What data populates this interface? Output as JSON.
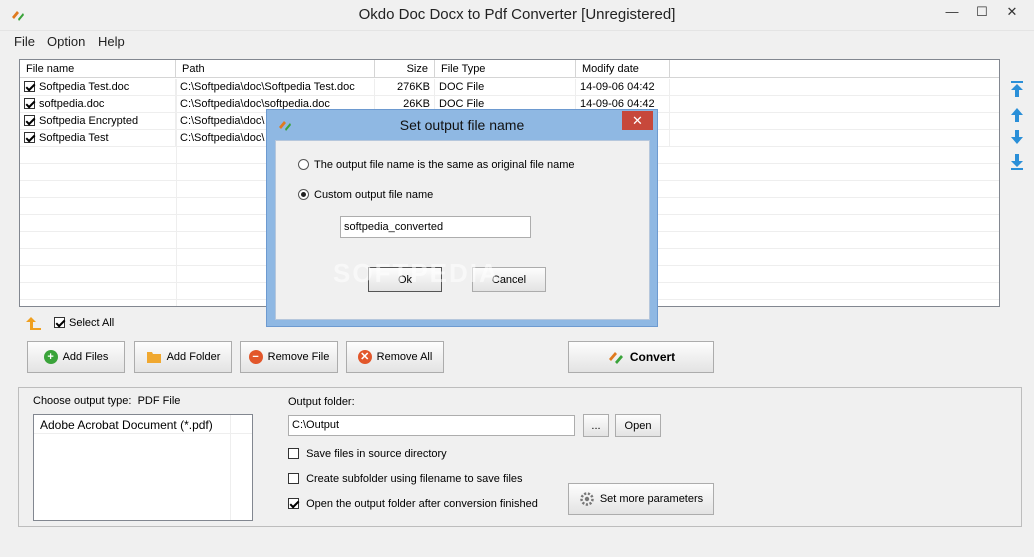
{
  "window": {
    "title": "Okdo Doc Docx to Pdf Converter [Unregistered]",
    "minimize": "—",
    "maximize": "☐",
    "close": "✕"
  },
  "menu": [
    "File",
    "Option",
    "Help"
  ],
  "table": {
    "columns": [
      "File name",
      "Path",
      "Size",
      "File Type",
      "Modify date"
    ],
    "rows": [
      {
        "checked": true,
        "name": "Softpedia Test.doc",
        "path": "C:\\Softpedia\\doc\\Softpedia Test.doc",
        "size": "276KB",
        "type": "DOC File",
        "date": "14-09-06 04:42"
      },
      {
        "checked": true,
        "name": "softpedia.doc",
        "path": "C:\\Softpedia\\doc\\softpedia.doc",
        "size": "26KB",
        "type": "DOC File",
        "date": "14-09-06 04:42"
      },
      {
        "checked": true,
        "name": "Softpedia Encrypted",
        "path": "C:\\Softpedia\\doc\\",
        "size": "",
        "type": "",
        "date": ""
      },
      {
        "checked": true,
        "name": "Softpedia Test",
        "path": "C:\\Softpedia\\doc\\",
        "size": "",
        "type": "",
        "date": ""
      }
    ]
  },
  "select_all": {
    "label": "Select All",
    "checked": true
  },
  "buttons": {
    "add_files": "Add Files",
    "add_folder": "Add Folder",
    "remove_file": "Remove File",
    "remove_all": "Remove All",
    "convert": "Convert"
  },
  "output": {
    "type_label": "Choose output type:",
    "type_value": "PDF File",
    "type_options": [
      "Adobe Acrobat Document (*.pdf)"
    ],
    "folder_label": "Output folder:",
    "folder_value": "C:\\Output",
    "browse": "...",
    "open": "Open",
    "options": [
      {
        "label": "Save files in source directory",
        "checked": false
      },
      {
        "label": "Create subfolder using filename to save files",
        "checked": false
      },
      {
        "label": "Open the output folder after conversion finished",
        "checked": true
      }
    ],
    "more_params": "Set more parameters"
  },
  "dialog": {
    "title": "Set output file name",
    "close": "✕",
    "option_same": "The output file name is the same as original file name",
    "option_custom": "Custom output file name",
    "selected": "custom",
    "custom_value": "softpedia_converted",
    "ok": "Ok",
    "cancel": "Cancel"
  },
  "watermark": "SOFTPEDIA",
  "colors": {
    "accent_green": "#3aa33a",
    "close_red": "#c7483b",
    "dialog_frame": "#8fb8e3",
    "arrow_blue": "#2a8fd8"
  }
}
